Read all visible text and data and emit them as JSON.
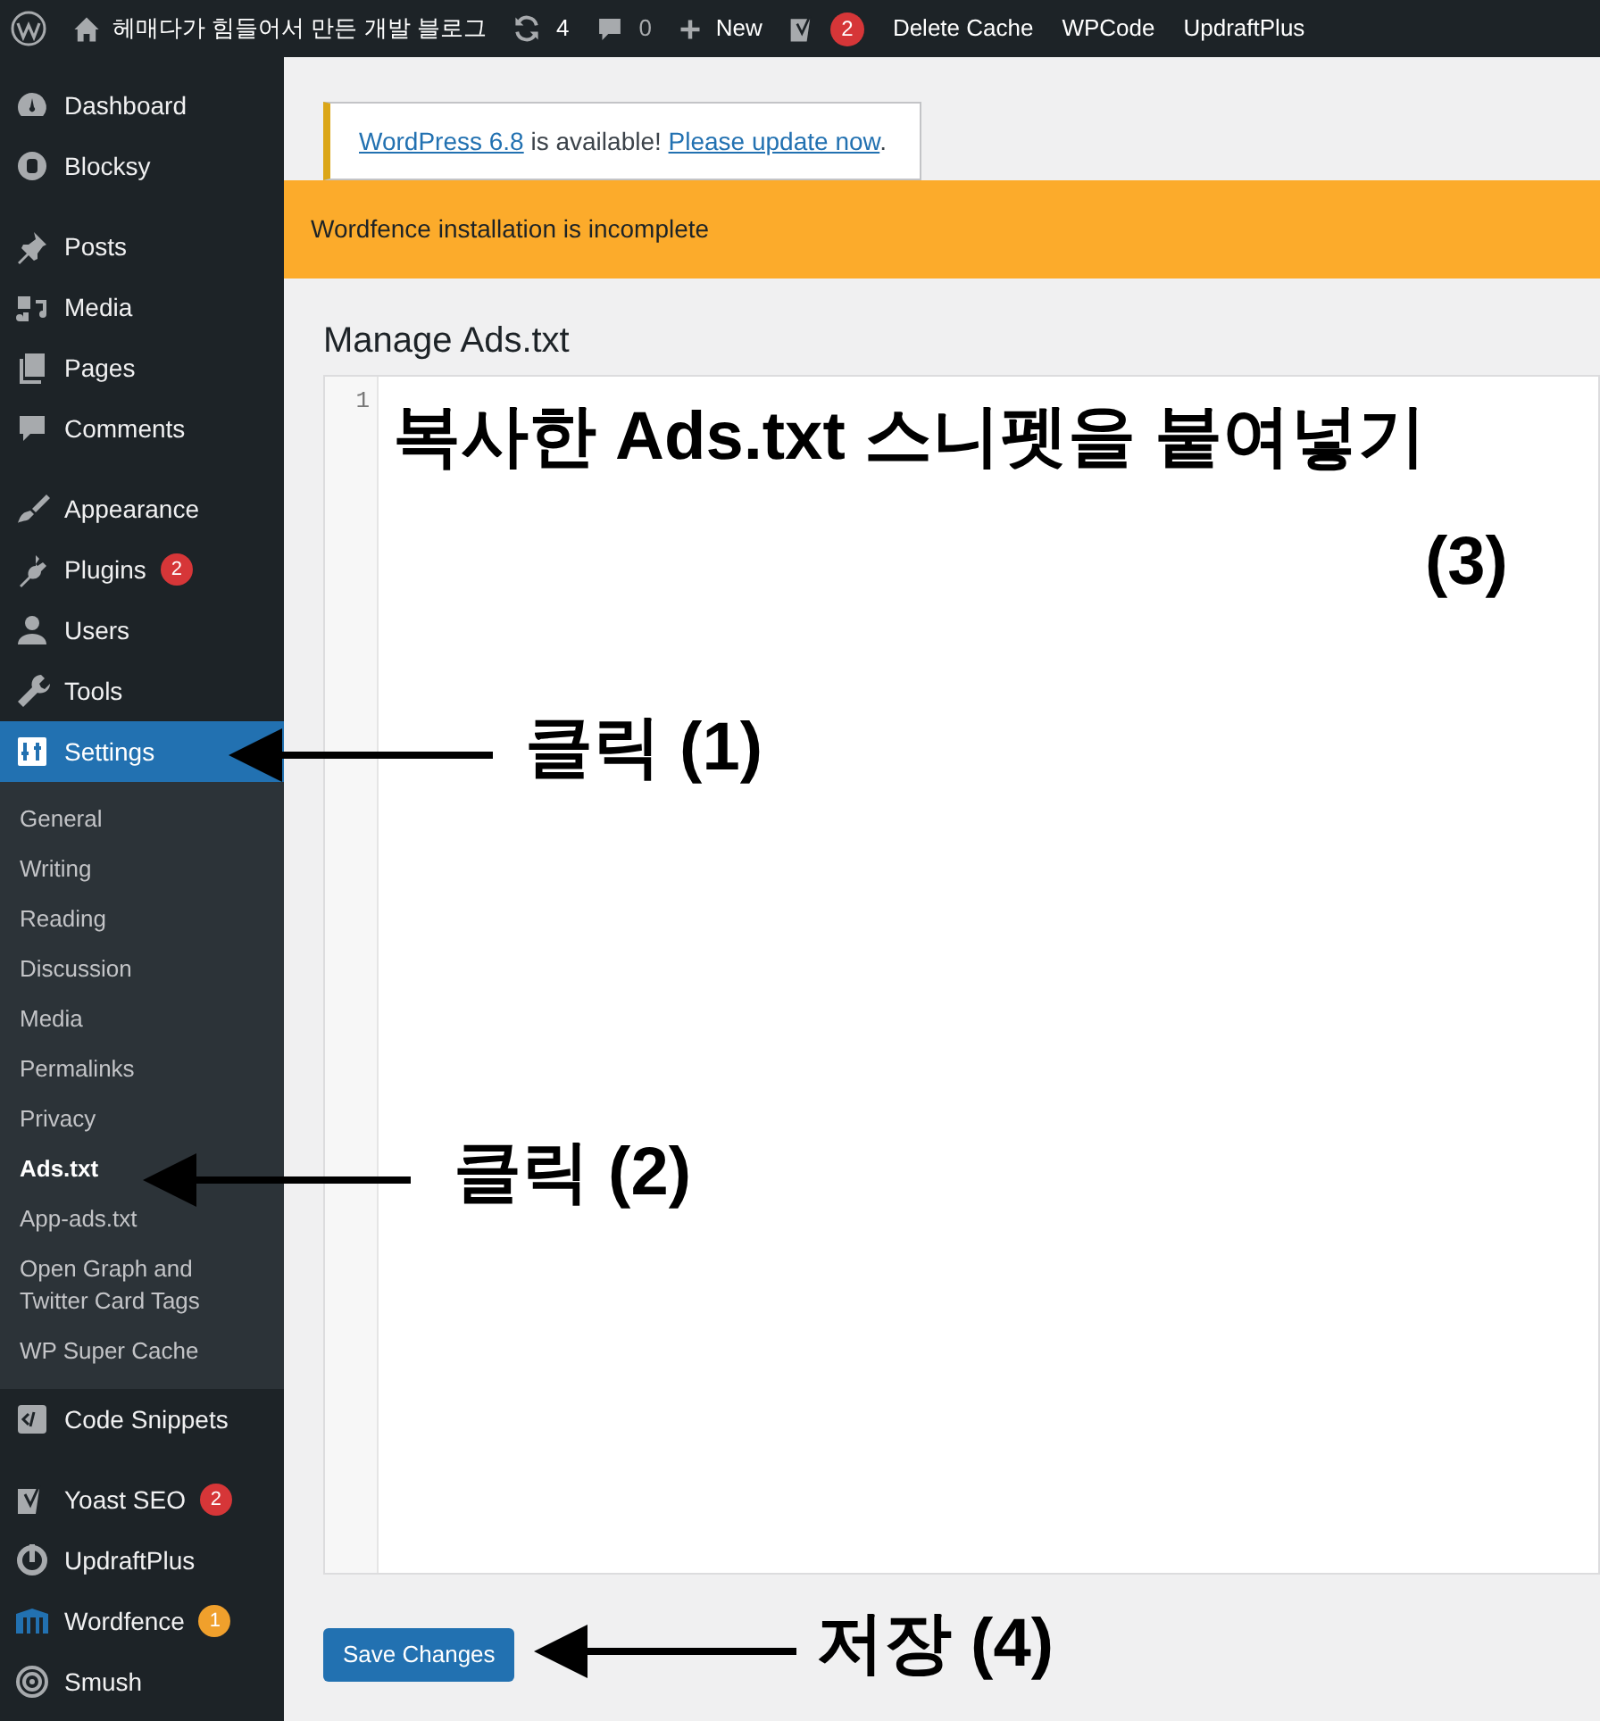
{
  "admin_bar": {
    "site_name": "헤매다가 힘들어서 만든 개발 블로그",
    "updates": "4",
    "comments": "0",
    "new_label": "New",
    "yoast_badge": "2",
    "links": [
      "Delete Cache",
      "WPCode",
      "UpdraftPlus"
    ]
  },
  "sidebar": {
    "items": [
      {
        "label": "Dashboard",
        "selected": false
      },
      {
        "label": "Blocksy",
        "selected": false
      },
      {
        "label": "Posts",
        "selected": false
      },
      {
        "label": "Media",
        "selected": false
      },
      {
        "label": "Pages",
        "selected": false
      },
      {
        "label": "Comments",
        "selected": false
      },
      {
        "label": "Appearance",
        "selected": false
      },
      {
        "label": "Plugins",
        "selected": false,
        "badge": {
          "text": "2",
          "color": "#d63638"
        }
      },
      {
        "label": "Users",
        "selected": false
      },
      {
        "label": "Tools",
        "selected": false
      },
      {
        "label": "Settings",
        "selected": true,
        "submenu": [
          {
            "label": "General",
            "selected": false
          },
          {
            "label": "Writing",
            "selected": false
          },
          {
            "label": "Reading",
            "selected": false
          },
          {
            "label": "Discussion",
            "selected": false
          },
          {
            "label": "Media",
            "selected": false
          },
          {
            "label": "Permalinks",
            "selected": false
          },
          {
            "label": "Privacy",
            "selected": false
          },
          {
            "label": "Ads.txt",
            "selected": true
          },
          {
            "label": "App-ads.txt",
            "selected": false
          },
          {
            "label": "Open Graph and Twitter Card Tags",
            "selected": false
          },
          {
            "label": "WP Super Cache",
            "selected": false
          }
        ]
      },
      {
        "label": "Code Snippets",
        "selected": false
      },
      {
        "label": "Yoast SEO",
        "selected": false,
        "badge": {
          "text": "2",
          "color": "#d63638"
        }
      },
      {
        "label": "UpdraftPlus",
        "selected": false
      },
      {
        "label": "Wordfence",
        "selected": false,
        "badge": {
          "text": "1",
          "color": "#f0a02c"
        }
      },
      {
        "label": "Smush",
        "selected": false
      }
    ]
  },
  "update_notice": {
    "link1": "WordPress 6.8",
    "middle": " is available! ",
    "link2": "Please update now",
    "end": "."
  },
  "wordfence_notice": "Wordfence installation is incomplete",
  "heading": "Manage Ads.txt",
  "editor": {
    "line_numbers": [
      "1"
    ]
  },
  "save_button": "Save Changes",
  "annotations": [
    "복사한 Ads.txt 스니펫을 붙여넣기",
    "(3)",
    "클릭 (1)",
    "클릭 (2)",
    "저장 (4)"
  ]
}
